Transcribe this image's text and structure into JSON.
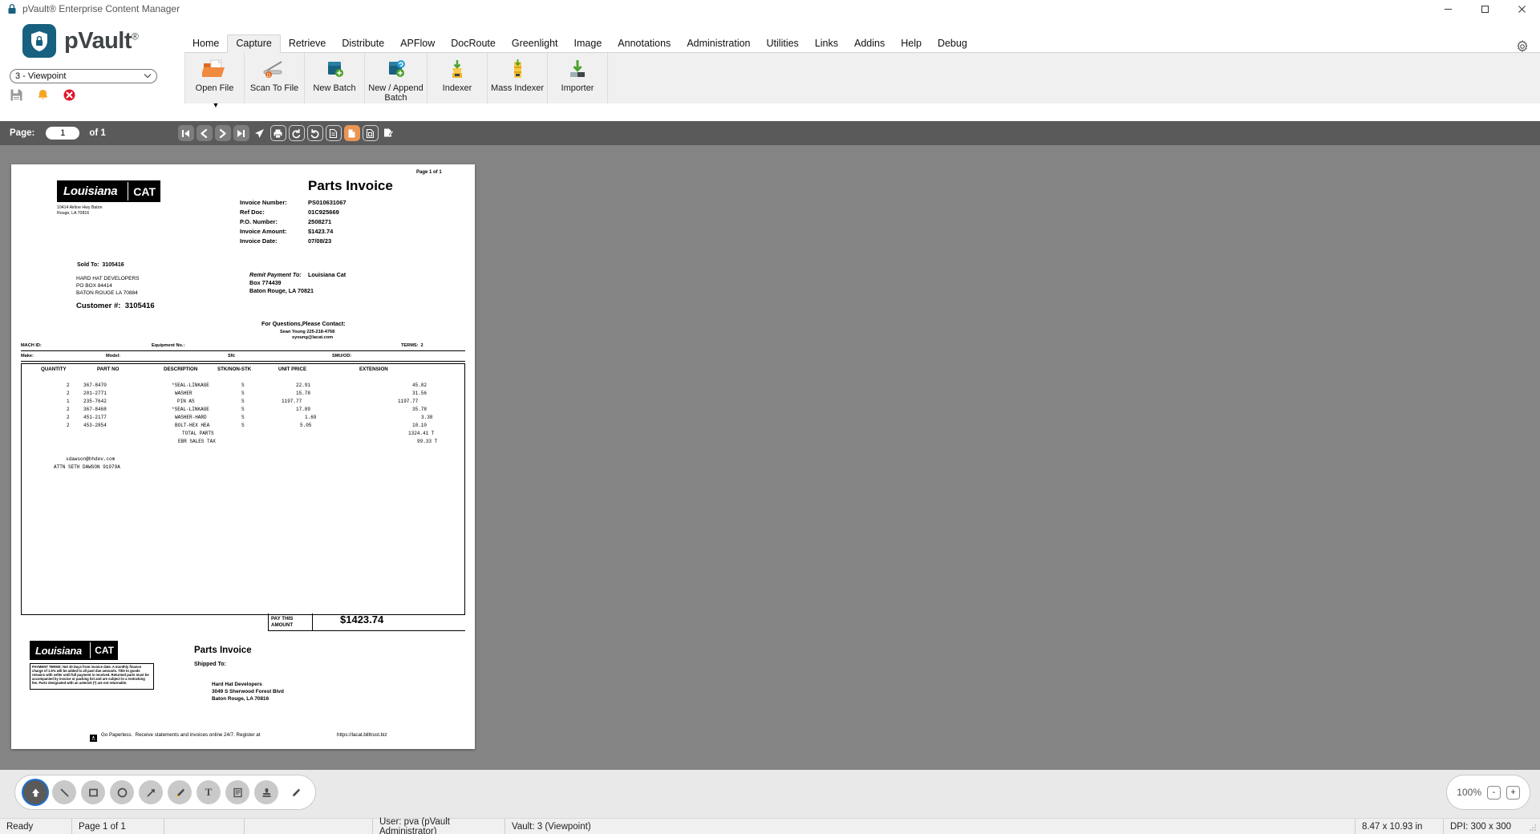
{
  "window": {
    "title": "pVault® Enterprise Content Manager",
    "icon": "lock-icon",
    "minimize": "—",
    "maximize": "▢",
    "close": "✕"
  },
  "brand": {
    "name": "pVault",
    "registered": "®",
    "logo_icon": "shield-lock-icon",
    "logo_color": "#17607f"
  },
  "vault_selector": {
    "value": "3 - Viewpoint",
    "caret": "chevron-down-icon"
  },
  "quick_actions": [
    {
      "name": "save-icon",
      "label": "Save",
      "color": "#9a9a9a"
    },
    {
      "name": "notifications-bell-icon",
      "label": "Notifications",
      "color": "#f5a623"
    },
    {
      "name": "close-error-icon",
      "label": "Close",
      "color": "#e0152b"
    }
  ],
  "ribbon": {
    "tabs": [
      {
        "label": "Home",
        "active": false
      },
      {
        "label": "Capture",
        "active": true
      },
      {
        "label": "Retrieve",
        "active": false
      },
      {
        "label": "Distribute",
        "active": false
      },
      {
        "label": "APFlow",
        "active": false
      },
      {
        "label": "DocRoute",
        "active": false
      },
      {
        "label": "Greenlight",
        "active": false
      },
      {
        "label": "Image",
        "active": false
      },
      {
        "label": "Annotations",
        "active": false
      },
      {
        "label": "Administration",
        "active": false
      },
      {
        "label": "Utilities",
        "active": false
      },
      {
        "label": "Links",
        "active": false
      },
      {
        "label": "Addins",
        "active": false
      },
      {
        "label": "Help",
        "active": false
      },
      {
        "label": "Debug",
        "active": false
      }
    ],
    "items": [
      {
        "label": "Open File",
        "icon": "open-folder-icon",
        "has_dropdown": true
      },
      {
        "label": "Scan To File",
        "icon": "scanner-icon",
        "has_dropdown": false
      },
      {
        "label": "New Batch",
        "icon": "new-batch-icon",
        "has_dropdown": false
      },
      {
        "label": "New / Append Batch",
        "icon": "append-batch-icon",
        "has_dropdown": false
      },
      {
        "label": "Indexer",
        "icon": "indexer-icon",
        "has_dropdown": false
      },
      {
        "label": "Mass Indexer",
        "icon": "mass-indexer-icon",
        "has_dropdown": false
      },
      {
        "label": "Importer",
        "icon": "importer-icon",
        "has_dropdown": false
      }
    ],
    "dropdown_caret": "▼"
  },
  "nav_toolbar": {
    "page_label": "Page:",
    "page_value": "1",
    "of_label": "of 1",
    "buttons": [
      {
        "name": "first-page-button",
        "glyph": "K",
        "style": "filled"
      },
      {
        "name": "previous-page-button",
        "glyph": "‹",
        "style": "filled"
      },
      {
        "name": "next-page-button",
        "glyph": "›",
        "style": "filled"
      },
      {
        "name": "last-page-button",
        "glyph": "Ӿ",
        "style": "filled"
      },
      {
        "name": "send-button",
        "glyph": "send",
        "style": "plain"
      },
      {
        "name": "print-button",
        "glyph": "print",
        "style": "outline"
      },
      {
        "name": "rotate-left-button",
        "glyph": "↺",
        "style": "outline"
      },
      {
        "name": "rotate-right-button",
        "glyph": "↻",
        "style": "outline"
      },
      {
        "name": "fit-width-button",
        "glyph": "page",
        "style": "outline"
      },
      {
        "name": "fit-page-button",
        "glyph": "page",
        "style": "selected"
      },
      {
        "name": "actual-size-button",
        "glyph": "page",
        "style": "outline"
      },
      {
        "name": "edit-page-button",
        "glyph": "page-edit",
        "style": "plain"
      }
    ]
  },
  "document": {
    "page_indicator": "Page 1 of 1",
    "title": "Parts Invoice",
    "vendor_logo": {
      "word1": "Louisiana",
      "word2": "CAT"
    },
    "vendor_address_line1": "10414 Airline Hwy Baton",
    "vendor_address_line2": "Rouge, LA 70816",
    "fields": [
      {
        "label": "Invoice Number:",
        "value": "PS010631067"
      },
      {
        "label": "Ref Doc:",
        "value": "01C925669"
      },
      {
        "label": "P.O. Number:",
        "value": "2508271"
      },
      {
        "label": "Invoice Amount:",
        "value": "$1423.74"
      },
      {
        "label": "Invoice Date:",
        "value": "07/08/23"
      }
    ],
    "sold_to_label": "Sold To:  3105416",
    "sold_to_lines": [
      "HARD HAT DEVELOPERS",
      "PO BOX 84414",
      "BATON ROUGE LA 70884"
    ],
    "customer_number": "Customer #:  3105416",
    "remit_label": "Remit Payment To:",
    "remit_name": "Louisiana Cat",
    "remit_lines": [
      "Box 774439",
      "Baton Rouge, LA 70821"
    ],
    "contact_heading": "For Questions,Please Contact:",
    "contact_name": "Sean Young 225-218-4768",
    "contact_email": "syoung@lacat.com",
    "equipment_row": [
      {
        "label": "MACH ID:"
      },
      {
        "label": "Equipment No.:"
      },
      {
        "label": "TERMS:  2"
      }
    ],
    "make_row": [
      {
        "label": "Make:"
      },
      {
        "label": "Model:"
      },
      {
        "label": "SN:"
      },
      {
        "label": "SMU/OD:"
      }
    ],
    "table_headers": [
      "QUANTITY",
      "PART NO",
      "DESCRIPTION",
      "STK/NON-STK",
      "UNIT PRICE",
      "EXTENSION"
    ],
    "line_items": [
      {
        "qty": "2",
        "part_no": "367-8470",
        "description": "*SEAL-LINKAGE",
        "stk": "S",
        "unit_price": "22.91",
        "extension": "45.82"
      },
      {
        "qty": "2",
        "part_no": "201-2771",
        "description": "WASHER",
        "stk": "S",
        "unit_price": "15.78",
        "extension": "31.56"
      },
      {
        "qty": "1",
        "part_no": "235-7642",
        "description": "PIN AS",
        "stk": "S",
        "unit_price": "1197.77",
        "extension": "1197.77"
      },
      {
        "qty": "2",
        "part_no": "367-8468",
        "description": "*SEAL-LINKAGE",
        "stk": "S",
        "unit_price": "17.89",
        "extension": "35.78"
      },
      {
        "qty": "2",
        "part_no": "451-2177",
        "description": "WASHER-HARD",
        "stk": "S",
        "unit_price": "1.69",
        "extension": "3.38"
      },
      {
        "qty": "2",
        "part_no": "453-2854",
        "description": "BOLT-HEX HEA",
        "stk": "S",
        "unit_price": "5.05",
        "extension": "10.10"
      }
    ],
    "totals": [
      {
        "label": "TOTAL PARTS",
        "value": "1324.41 T"
      },
      {
        "label": "EBR SALES TAX",
        "value": "99.33 T"
      }
    ],
    "attn_email": "sdawson@hhdev.com",
    "attn_line": "ATTN SETH DAWSON 91979A",
    "pay_this_amount_label_1": "PAY THIS",
    "pay_this_amount_label_2": "AMOUNT",
    "pay_this_amount_value": "$1423.74",
    "stub_title": "Parts Invoice",
    "shipped_to_label": "Shipped To:",
    "shipped_to_lines": [
      "Hard Hat Developers",
      "3049 S Sherwood Forest Blvd",
      "Baton Rouge, LA 70816"
    ],
    "payment_terms": "PAYMENT TERMS: Net 30 Days from invoice date. A monthly finance charge of 1.5% will be added to all past due amounts. Title to goods remains with seller until full payment is received. Returned parts must be accompanied by invoice or packing list and are subject to a restocking fee. Parts designated with an asterisk (*) are not returnable.",
    "footer_icon": "recycle-icon",
    "footer_text": "Go Paperless.  Receive statements and invoices online 24/7. Register at",
    "footer_url": "https://lacat.billtrust.biz"
  },
  "annotation_tools": [
    {
      "name": "select-arrow-tool",
      "glyph": "⬆",
      "active": true
    },
    {
      "name": "line-tool",
      "glyph": "╲",
      "active": false
    },
    {
      "name": "rectangle-tool",
      "glyph": "▢",
      "active": false
    },
    {
      "name": "ellipse-tool",
      "glyph": "◯",
      "active": false
    },
    {
      "name": "arrow-tool",
      "glyph": "↗",
      "active": false
    },
    {
      "name": "highlighter-tool",
      "glyph": "✎",
      "active": false
    },
    {
      "name": "text-tool",
      "glyph": "T",
      "active": false
    },
    {
      "name": "note-tool",
      "glyph": "▤",
      "active": false
    },
    {
      "name": "stamp-tool",
      "glyph": "⚲",
      "active": false
    },
    {
      "name": "pen-tool",
      "glyph": "✏",
      "active": false
    }
  ],
  "zoom_control": {
    "level": "100%",
    "minus": "-",
    "plus": "+"
  },
  "status_bar": {
    "ready": "Ready",
    "page": "Page 1 of 1",
    "blank1": "",
    "blank2": "",
    "user": "User: pva (pVault Administrator)",
    "vault": "Vault: 3 (Viewpoint)",
    "dimensions": "8.47 x 10.93 in",
    "dpi": "DPI: 300 x 300"
  }
}
